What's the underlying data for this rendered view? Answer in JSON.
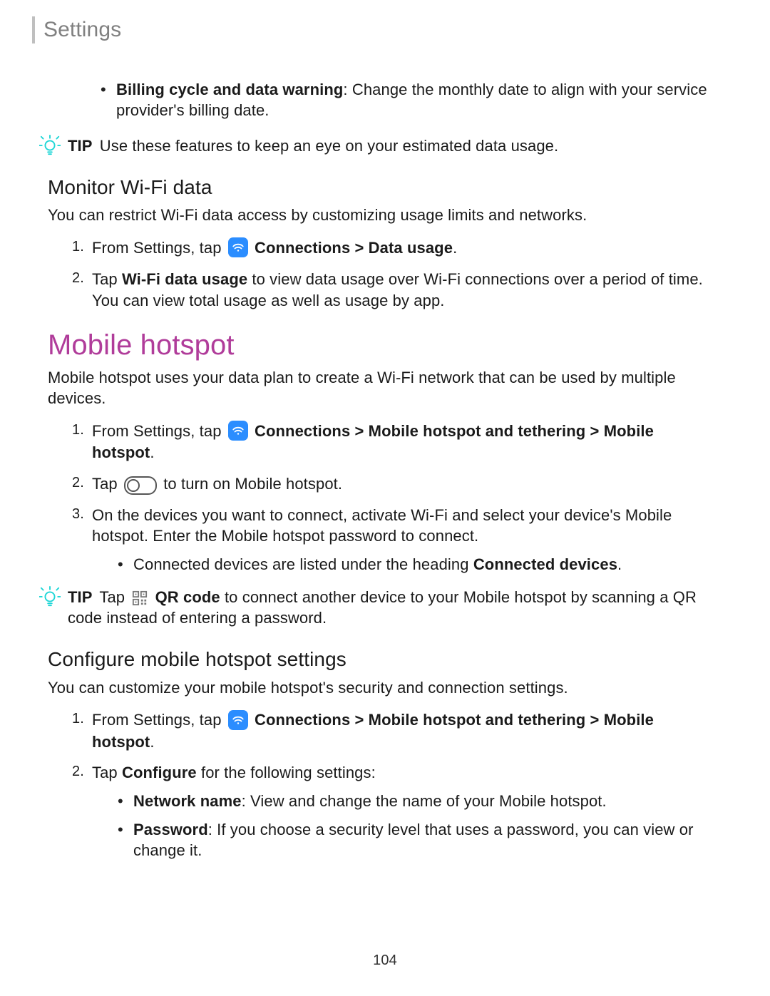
{
  "header": {
    "title": "Settings"
  },
  "bullet_billing": {
    "label": "Billing cycle and data warning",
    "rest": ": Change the monthly date to align with your service provider's billing date."
  },
  "tip1": {
    "label": "TIP",
    "text": "Use these features to keep an eye on your estimated data usage."
  },
  "monitor": {
    "heading": "Monitor Wi-Fi data",
    "intro": "You can restrict Wi-Fi data access by customizing usage limits and networks.",
    "step1_pre": "From Settings, tap",
    "step1_nav": "Connections > Data usage",
    "step1_end": ".",
    "step2_a": "Tap ",
    "step2_bold": "Wi-Fi data usage",
    "step2_b": " to view data usage over Wi-Fi connections over a period of time. You can view total usage as well as usage by app."
  },
  "hotspot": {
    "heading": "Mobile hotspot",
    "intro": "Mobile hotspot uses your data plan to create a Wi-Fi network that can be used by multiple devices.",
    "step1_pre": "From Settings, tap",
    "step1_nav1": "Connections > Mobile hotspot and tethering > Mobile hotspot",
    "step1_end": ".",
    "step2_pre": "Tap",
    "step2_post": "to turn on Mobile hotspot.",
    "step3": "On the devices you want to connect, activate Wi-Fi and select your device's Mobile hotspot. Enter the Mobile hotspot password to connect.",
    "step3_sub_a": "Connected devices are listed under the heading ",
    "step3_sub_b": "Connected devices",
    "step3_sub_c": "."
  },
  "tip2": {
    "label": "TIP",
    "pre": "Tap",
    "bold": "QR code",
    "post": " to connect another device to your Mobile hotspot by scanning a QR code instead of entering a password."
  },
  "configure": {
    "heading": "Configure mobile hotspot settings",
    "intro": "You can customize your mobile hotspot's security and connection settings.",
    "step1_pre": "From Settings, tap",
    "step1_nav": "Connections > Mobile hotspot and tethering > Mobile hotspot",
    "step1_end": ".",
    "step2_a": "Tap ",
    "step2_bold": "Configure",
    "step2_b": " for the following settings:",
    "sub1_label": "Network name",
    "sub1_rest": ": View and change the name of your Mobile hotspot.",
    "sub2_label": "Password",
    "sub2_rest": ": If you choose a security level that uses a password, you can view or change it."
  },
  "page_number": "104"
}
